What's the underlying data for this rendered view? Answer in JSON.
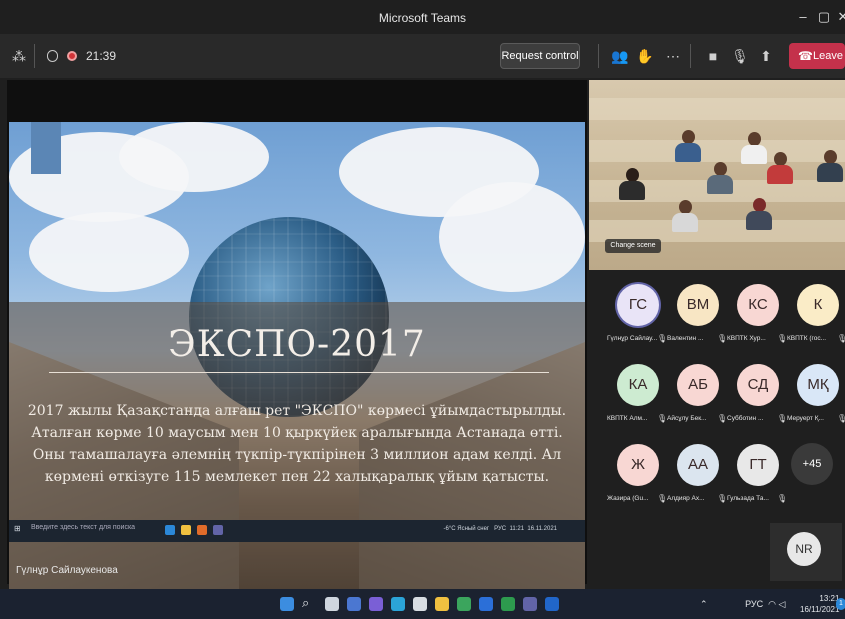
{
  "window": {
    "title": "Microsoft Teams",
    "minimize_icon": "–",
    "restore_icon": "▢",
    "close_icon": "✕"
  },
  "meeting_bar": {
    "timer": "21:39",
    "request_control_label": "Request control",
    "leave_label": "Leave"
  },
  "slide": {
    "title": "ЭКСПО-2017",
    "body": "2017 жылы Қазақстанда алғаш рет \"ЭКСПО\" көрмесі ұйымдастырылды. Аталған көрме 10 маусым мен 10 қыркүйек аралығында Астанада өтті. Оны тамашалауға әлемнің түкпір-түкпірінен 3 миллион адам келді. Ал көрмені өткізуге 115 мемлекет пен 22 халықаралық ұйым қатысты."
  },
  "inner_taskbar": {
    "search_placeholder": "Введите здесь текст для поиска",
    "weather": "-6°C Ясный снег",
    "lang": "РУС",
    "time": "11:21",
    "date": "16.11.2021"
  },
  "presenter_name": "Гүлнұр Сайлаукенова",
  "video": {
    "change_scene_label": "Change scene"
  },
  "participants": [
    {
      "initials": "ГС",
      "name": "Гүлнұр Сайлау...",
      "color": "#e9e4f7"
    },
    {
      "initials": "ВМ",
      "name": "Валентин ...",
      "color": "#f8e6c4"
    },
    {
      "initials": "КС",
      "name": "КВПТК Хур...",
      "color": "#f8d7d3"
    },
    {
      "initials": "К",
      "name": "КВПТК (гос...",
      "color": "#faecc7"
    },
    {
      "initials": "КА",
      "name": "КВПТК Алм...",
      "color": "#cdebd1"
    },
    {
      "initials": "АБ",
      "name": "Айсұлу Бек...",
      "color": "#f8d7d3"
    },
    {
      "initials": "СД",
      "name": "Субботин ...",
      "color": "#f8d7d3"
    },
    {
      "initials": "МҚ",
      "name": "Меруерт Қ...",
      "color": "#d9e7f7"
    },
    {
      "initials": "Ж",
      "name": "Жазира (Gu...",
      "color": "#f8d7d3"
    },
    {
      "initials": "АА",
      "name": "Алдияр Ах...",
      "color": "#dbe5ef"
    },
    {
      "initials": "ГТ",
      "name": "Гульзада Та...",
      "color": "#e8e8e8"
    }
  ],
  "more_participants": "+45",
  "extra_participant": "NR",
  "taskbar": {
    "lang": "РУС",
    "time": "13:21",
    "date": "16/11/2021",
    "notification_count": "1"
  },
  "colors": {
    "leave": "#c4314b",
    "background": "#1f1f1f",
    "accent_blue": "#5b86b5"
  }
}
